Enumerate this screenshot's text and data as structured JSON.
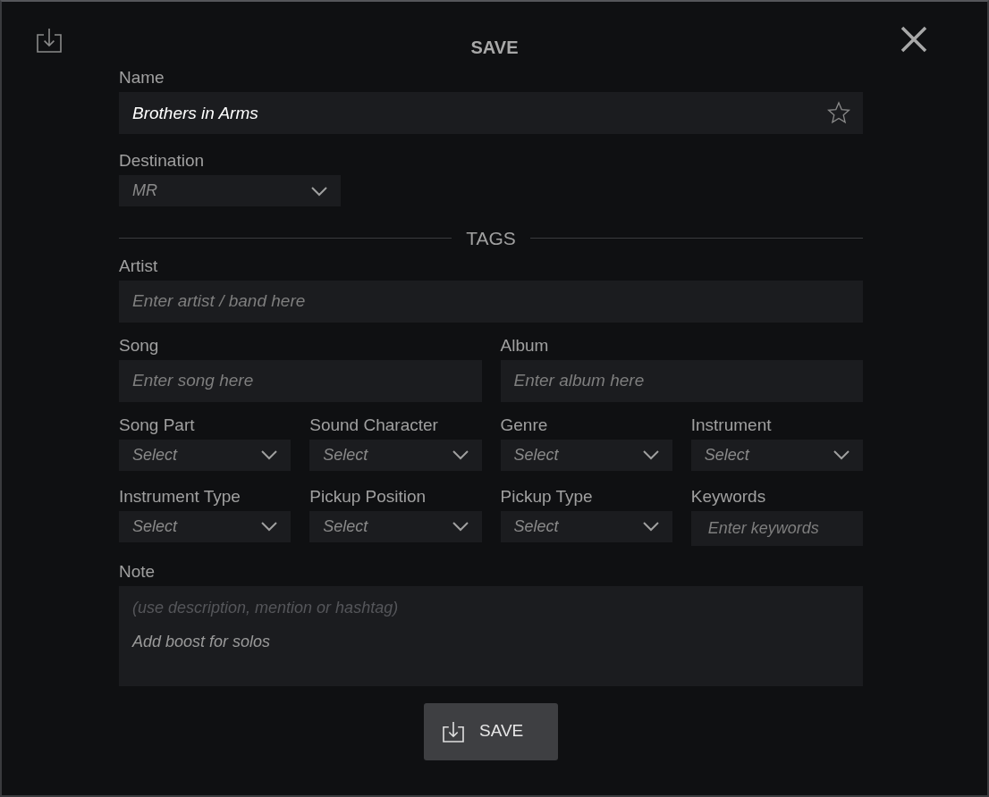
{
  "dialog": {
    "title": "SAVE"
  },
  "name": {
    "label": "Name",
    "value": "Brothers in Arms",
    "favorite": false
  },
  "destination": {
    "label": "Destination",
    "value": "MR"
  },
  "tags": {
    "heading": "TAGS",
    "artist": {
      "label": "Artist",
      "placeholder": "Enter artist / band here"
    },
    "song": {
      "label": "Song",
      "placeholder": "Enter song here"
    },
    "album": {
      "label": "Album",
      "placeholder": "Enter album here"
    },
    "fields": [
      {
        "kind": "select",
        "label": "Song Part",
        "placeholder": "Select"
      },
      {
        "kind": "select",
        "label": "Sound Character",
        "placeholder": "Select"
      },
      {
        "kind": "select",
        "label": "Genre",
        "placeholder": "Select"
      },
      {
        "kind": "select",
        "label": "Instrument",
        "placeholder": "Select"
      },
      {
        "kind": "select",
        "label": "Instrument Type",
        "placeholder": "Select"
      },
      {
        "kind": "select",
        "label": "Pickup Position",
        "placeholder": "Select"
      },
      {
        "kind": "select",
        "label": "Pickup Type",
        "placeholder": "Select"
      },
      {
        "kind": "text",
        "label": "Keywords",
        "placeholder": "Enter keywords"
      }
    ]
  },
  "note": {
    "label": "Note",
    "hint": "(use description, mention or hashtag)",
    "value": "Add boost for solos"
  },
  "save_button": {
    "label": "SAVE"
  }
}
